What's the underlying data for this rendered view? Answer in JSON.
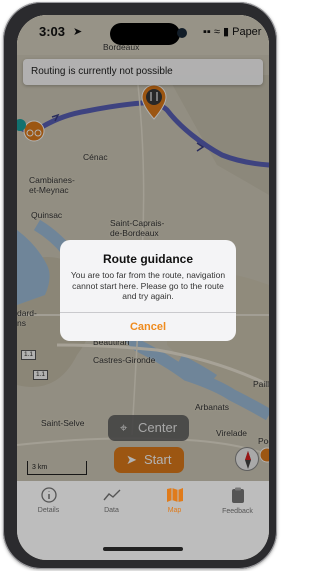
{
  "status_bar": {
    "time": "3:03",
    "right_text": "Paper"
  },
  "toast": {
    "message": "Routing is currently not possible"
  },
  "map": {
    "labels": {
      "bordeaux_top": "Bordeaux",
      "cenac": "Cénac",
      "cambianes": "Cambianes-\net-Meynac",
      "quinsac": "Quinsac",
      "saint_caprais": "Saint-Caprais-\nde-Bordeaux",
      "gradignan": "dard-\nns",
      "beautiran": "Beautiran",
      "castres": "Castres-Gironde",
      "road_1": "1.1",
      "road_2": "1.1",
      "arbanats": "Arbanats",
      "saint_selve": "Saint-Selve",
      "virelade": "Virelade",
      "podensac": "Pod",
      "paillet": "Paillet"
    },
    "scale_label": "3 km",
    "route_color": "#5a60b8",
    "water_color": "#9fbfdc"
  },
  "dialog": {
    "title": "Route guidance",
    "message": "You are too far from the route, navigation cannot start here. Please go to the route and try again.",
    "cancel_label": "Cancel"
  },
  "controls": {
    "center_label": "Center",
    "start_label": "Start"
  },
  "tabs": [
    {
      "label": "Details",
      "icon": "info-icon"
    },
    {
      "label": "Data",
      "icon": "chart-icon"
    },
    {
      "label": "Map",
      "icon": "map-icon",
      "active": true
    },
    {
      "label": "Feedback",
      "icon": "clipboard-icon"
    }
  ],
  "colors": {
    "accent": "#e07b1a",
    "dialog_button": "#ef8b1e"
  }
}
